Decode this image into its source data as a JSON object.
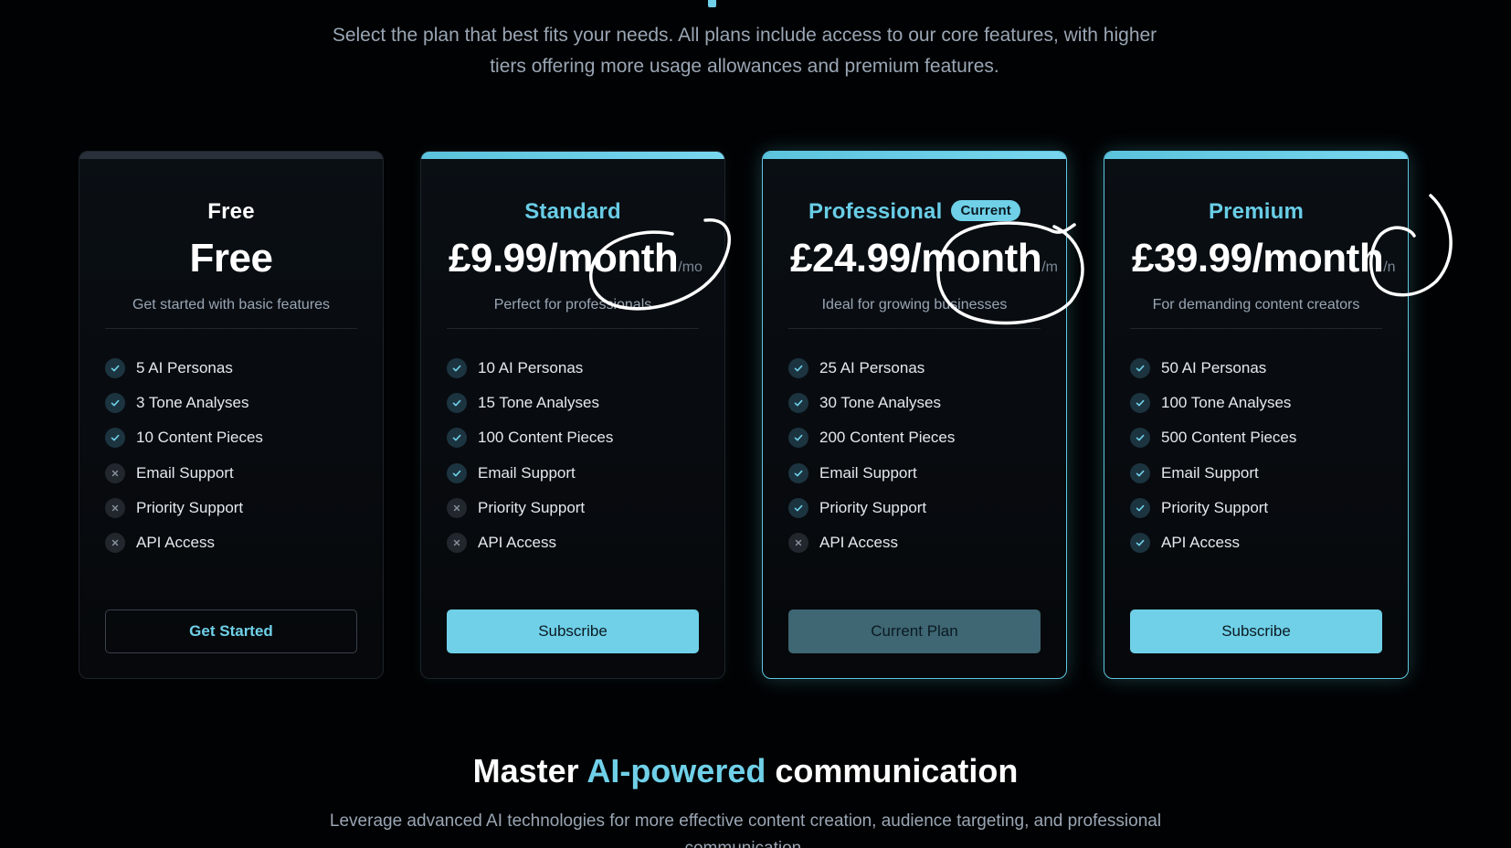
{
  "intro": {
    "line1": "Select the plan that best fits your needs. All plans include access to our core features, with higher",
    "line2": "tiers offering more usage allowances and premium features."
  },
  "plans": [
    {
      "name": "Free",
      "price": "Free",
      "per": "",
      "tagline": "Get started with basic features",
      "features": [
        {
          "label": "5 AI Personas",
          "included": true
        },
        {
          "label": "3 Tone Analyses",
          "included": true
        },
        {
          "label": "10 Content Pieces",
          "included": true
        },
        {
          "label": "Email Support",
          "included": false
        },
        {
          "label": "Priority Support",
          "included": false
        },
        {
          "label": "API Access",
          "included": false
        }
      ],
      "cta": "Get Started"
    },
    {
      "name": "Standard",
      "price": "£9.99/month",
      "per": "/mo",
      "tagline": "Perfect for professionals",
      "features": [
        {
          "label": "10 AI Personas",
          "included": true
        },
        {
          "label": "15 Tone Analyses",
          "included": true
        },
        {
          "label": "100 Content Pieces",
          "included": true
        },
        {
          "label": "Email Support",
          "included": true
        },
        {
          "label": "Priority Support",
          "included": false
        },
        {
          "label": "API Access",
          "included": false
        }
      ],
      "cta": "Subscribe"
    },
    {
      "name": "Professional",
      "badge": "Current",
      "price": "£24.99/month",
      "per": "/m",
      "tagline": "Ideal for growing businesses",
      "features": [
        {
          "label": "25 AI Personas",
          "included": true
        },
        {
          "label": "30 Tone Analyses",
          "included": true
        },
        {
          "label": "200 Content Pieces",
          "included": true
        },
        {
          "label": "Email Support",
          "included": true
        },
        {
          "label": "Priority Support",
          "included": true
        },
        {
          "label": "API Access",
          "included": false
        }
      ],
      "cta": "Current Plan"
    },
    {
      "name": "Premium",
      "price": "£39.99/month",
      "per": "/n",
      "tagline": "For demanding content creators",
      "features": [
        {
          "label": "50 AI Personas",
          "included": true
        },
        {
          "label": "100 Tone Analyses",
          "included": true
        },
        {
          "label": "500 Content Pieces",
          "included": true
        },
        {
          "label": "Email Support",
          "included": true
        },
        {
          "label": "Priority Support",
          "included": true
        },
        {
          "label": "API Access",
          "included": true
        }
      ],
      "cta": "Subscribe"
    }
  ],
  "headline": {
    "prefix": "Master ",
    "accent": "AI-powered",
    "suffix": " communication"
  },
  "sub": {
    "line1": "Leverage advanced AI technologies for more effective content creation, audience targeting, and professional",
    "line2": "communication."
  },
  "colors": {
    "background": "#010203",
    "accent": "#6fd0e8",
    "annotation": "#ffffff"
  },
  "icons": {
    "included": "check-icon",
    "excluded": "x-icon"
  }
}
